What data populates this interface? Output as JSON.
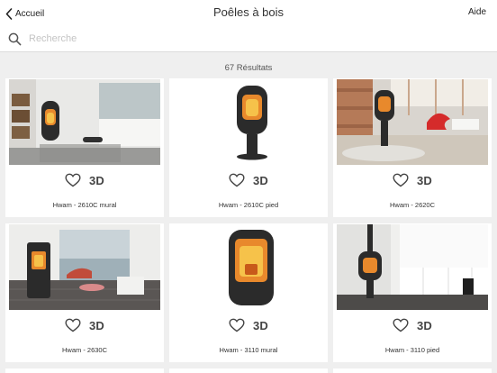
{
  "nav": {
    "back_label": "Accueil",
    "title": "Poêles à bois",
    "help_label": "Aide"
  },
  "search": {
    "placeholder": "Recherche"
  },
  "results": {
    "count_label": "67 Résultats"
  },
  "products": [
    {
      "name": "Hwam - 2610C mural",
      "view3d_label": "3D"
    },
    {
      "name": "Hwam - 2610C pied",
      "view3d_label": "3D"
    },
    {
      "name": "Hwam - 2620C",
      "view3d_label": "3D"
    },
    {
      "name": "Hwam - 2630C",
      "view3d_label": "3D"
    },
    {
      "name": "Hwam - 3110 mural",
      "view3d_label": "3D"
    },
    {
      "name": "Hwam - 3110 pied",
      "view3d_label": "3D"
    }
  ],
  "icons": {
    "back": "chevron-left-icon",
    "search": "search-icon",
    "favorite": "heart-icon"
  },
  "colors": {
    "background": "#efefef",
    "card": "#ffffff",
    "stove": "#2b2b2b",
    "flame": "#e8892c"
  }
}
